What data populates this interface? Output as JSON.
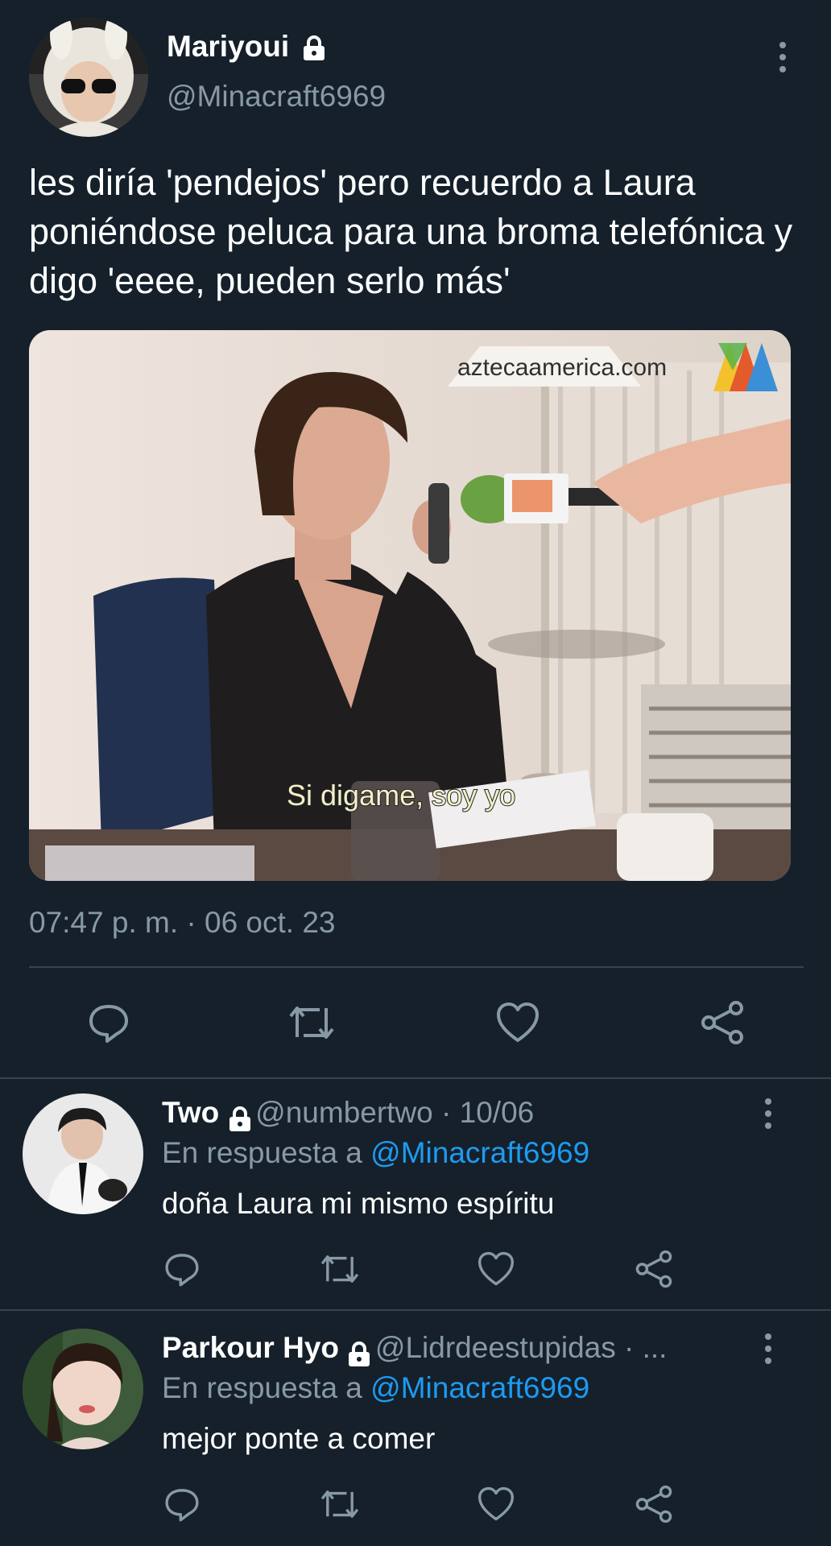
{
  "colors": {
    "background": "#15202b",
    "secondary_text": "#8899a6",
    "link": "#1d9bf0",
    "divider": "#38444d"
  },
  "main_tweet": {
    "display_name": "Mariyoui",
    "handle": "@Minacraft6969",
    "text": "les diría 'pendejos' pero recuerdo a Laura poniéndose peluca para una broma telefónica y digo 'eeee, pueden serlo más'",
    "media": {
      "watermark": "aztecaamerica.com",
      "subtitle": "Si digame, soy yo"
    },
    "timestamp": "07:47 p. m. · 06 oct. 23",
    "actions": [
      "reply-icon",
      "retweet-icon",
      "like-icon",
      "share-icon"
    ]
  },
  "replies": [
    {
      "display_name": "Two",
      "meta": "@numbertwo · 10/06",
      "reply_prefix": "En respuesta a ",
      "reply_to": "@Minacraft6969",
      "text": "doña Laura mi mismo espíritu"
    },
    {
      "display_name": "Parkour Hyo",
      "meta": "@Lidrdeestupidas · ...",
      "reply_prefix": "En respuesta a ",
      "reply_to": "@Minacraft6969",
      "text": "mejor ponte a comer"
    }
  ]
}
